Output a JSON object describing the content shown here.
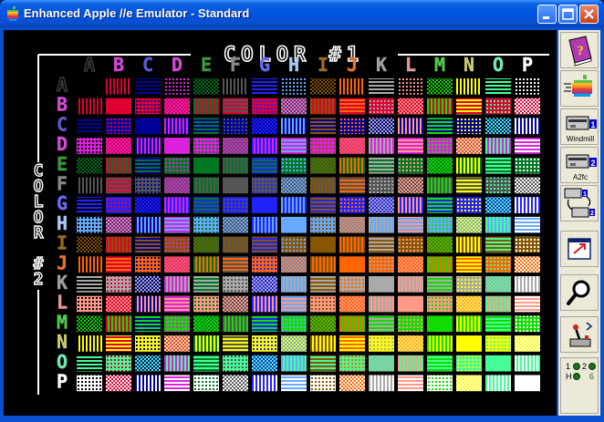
{
  "window": {
    "title": "Enhanced Apple //e Emulator - Standard",
    "colors": {
      "titlebar": "#0054e3",
      "screen_bg": "#000000",
      "text": "#ffffff",
      "toolbar_bg": "#ece9d8"
    }
  },
  "screen": {
    "heading": "COLOR #1",
    "side_label": [
      "C",
      "O",
      "L",
      "O",
      "R",
      "",
      "#",
      "2"
    ],
    "columns": [
      "A",
      "B",
      "C",
      "D",
      "E",
      "F",
      "G",
      "H",
      "I",
      "J",
      "K",
      "L",
      "M",
      "N",
      "O",
      "P"
    ],
    "rows": [
      "A",
      "B",
      "C",
      "D",
      "E",
      "F",
      "G",
      "H",
      "I",
      "J",
      "K",
      "L",
      "M",
      "N",
      "O",
      "P"
    ],
    "palette": [
      "#000000",
      "#dd0033",
      "#000099",
      "#dd22dd",
      "#007722",
      "#555555",
      "#2222ff",
      "#66aaff",
      "#885500",
      "#ff6600",
      "#aaaaaa",
      "#ff9988",
      "#11dd00",
      "#ffff00",
      "#44ff99",
      "#ffffff"
    ],
    "column_label_colors": [
      "#444444",
      "#d24ad2",
      "#5a5ad2",
      "#d24ad2",
      "#3a9a3a",
      "#888888",
      "#6a6aee",
      "#a8c8f0",
      "#9a6a2a",
      "#e8722a",
      "#a0a0a0",
      "#e89a9a",
      "#52c852",
      "#c8c872",
      "#72e8b2",
      "#ffffff"
    ]
  },
  "toolbar": {
    "help_icon": "help-book-icon",
    "run_icon": "apple-run-icon",
    "drive1_label": "Windmill",
    "drive2_label": "A2fc",
    "swap_icon": "swap-disks-icon",
    "fullscreen_icon": "fullscreen-icon",
    "debug_icon": "magnifier-icon",
    "settings_icon": "joystick-settings-icon"
  },
  "status": {
    "led1_label": "1",
    "led2_label": "2",
    "led3_label": "H",
    "led4_label": "6"
  }
}
